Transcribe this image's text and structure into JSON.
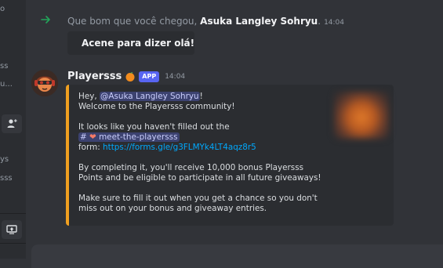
{
  "sidebar": {
    "fragments": [
      "o",
      "ss",
      "u...",
      "ys",
      "sss"
    ]
  },
  "join_message": {
    "text": "Que bom que você chegou, ",
    "username": "Asuka Langley Sohryu",
    "suffix": ".",
    "timestamp": "14:04",
    "wave_label": "Acene para dizer olá!"
  },
  "bot_message": {
    "username": "Playersss",
    "badge": "APP",
    "timestamp": "14:04",
    "embed": {
      "accent": "#f0a020",
      "greeting": "Hey, ",
      "mention": "@Asuka Langley Sohryu",
      "greeting_end": "!",
      "welcome": "Welcome to the Playersss community!",
      "p2_a": "It looks like you haven't filled out the ",
      "channel": "meet-the-playersss",
      "p2_b": "form: ",
      "link": "https://forms.gle/g3FLMYk4LT4aqz8r5",
      "p3": "By completing it, you'll receive 10,000 bonus Playersss Points and be eligible to participate in all future giveaways!",
      "p4": "Make sure to fill it out when you get a chance so you don't miss out on your bonus and giveaway entries."
    }
  }
}
